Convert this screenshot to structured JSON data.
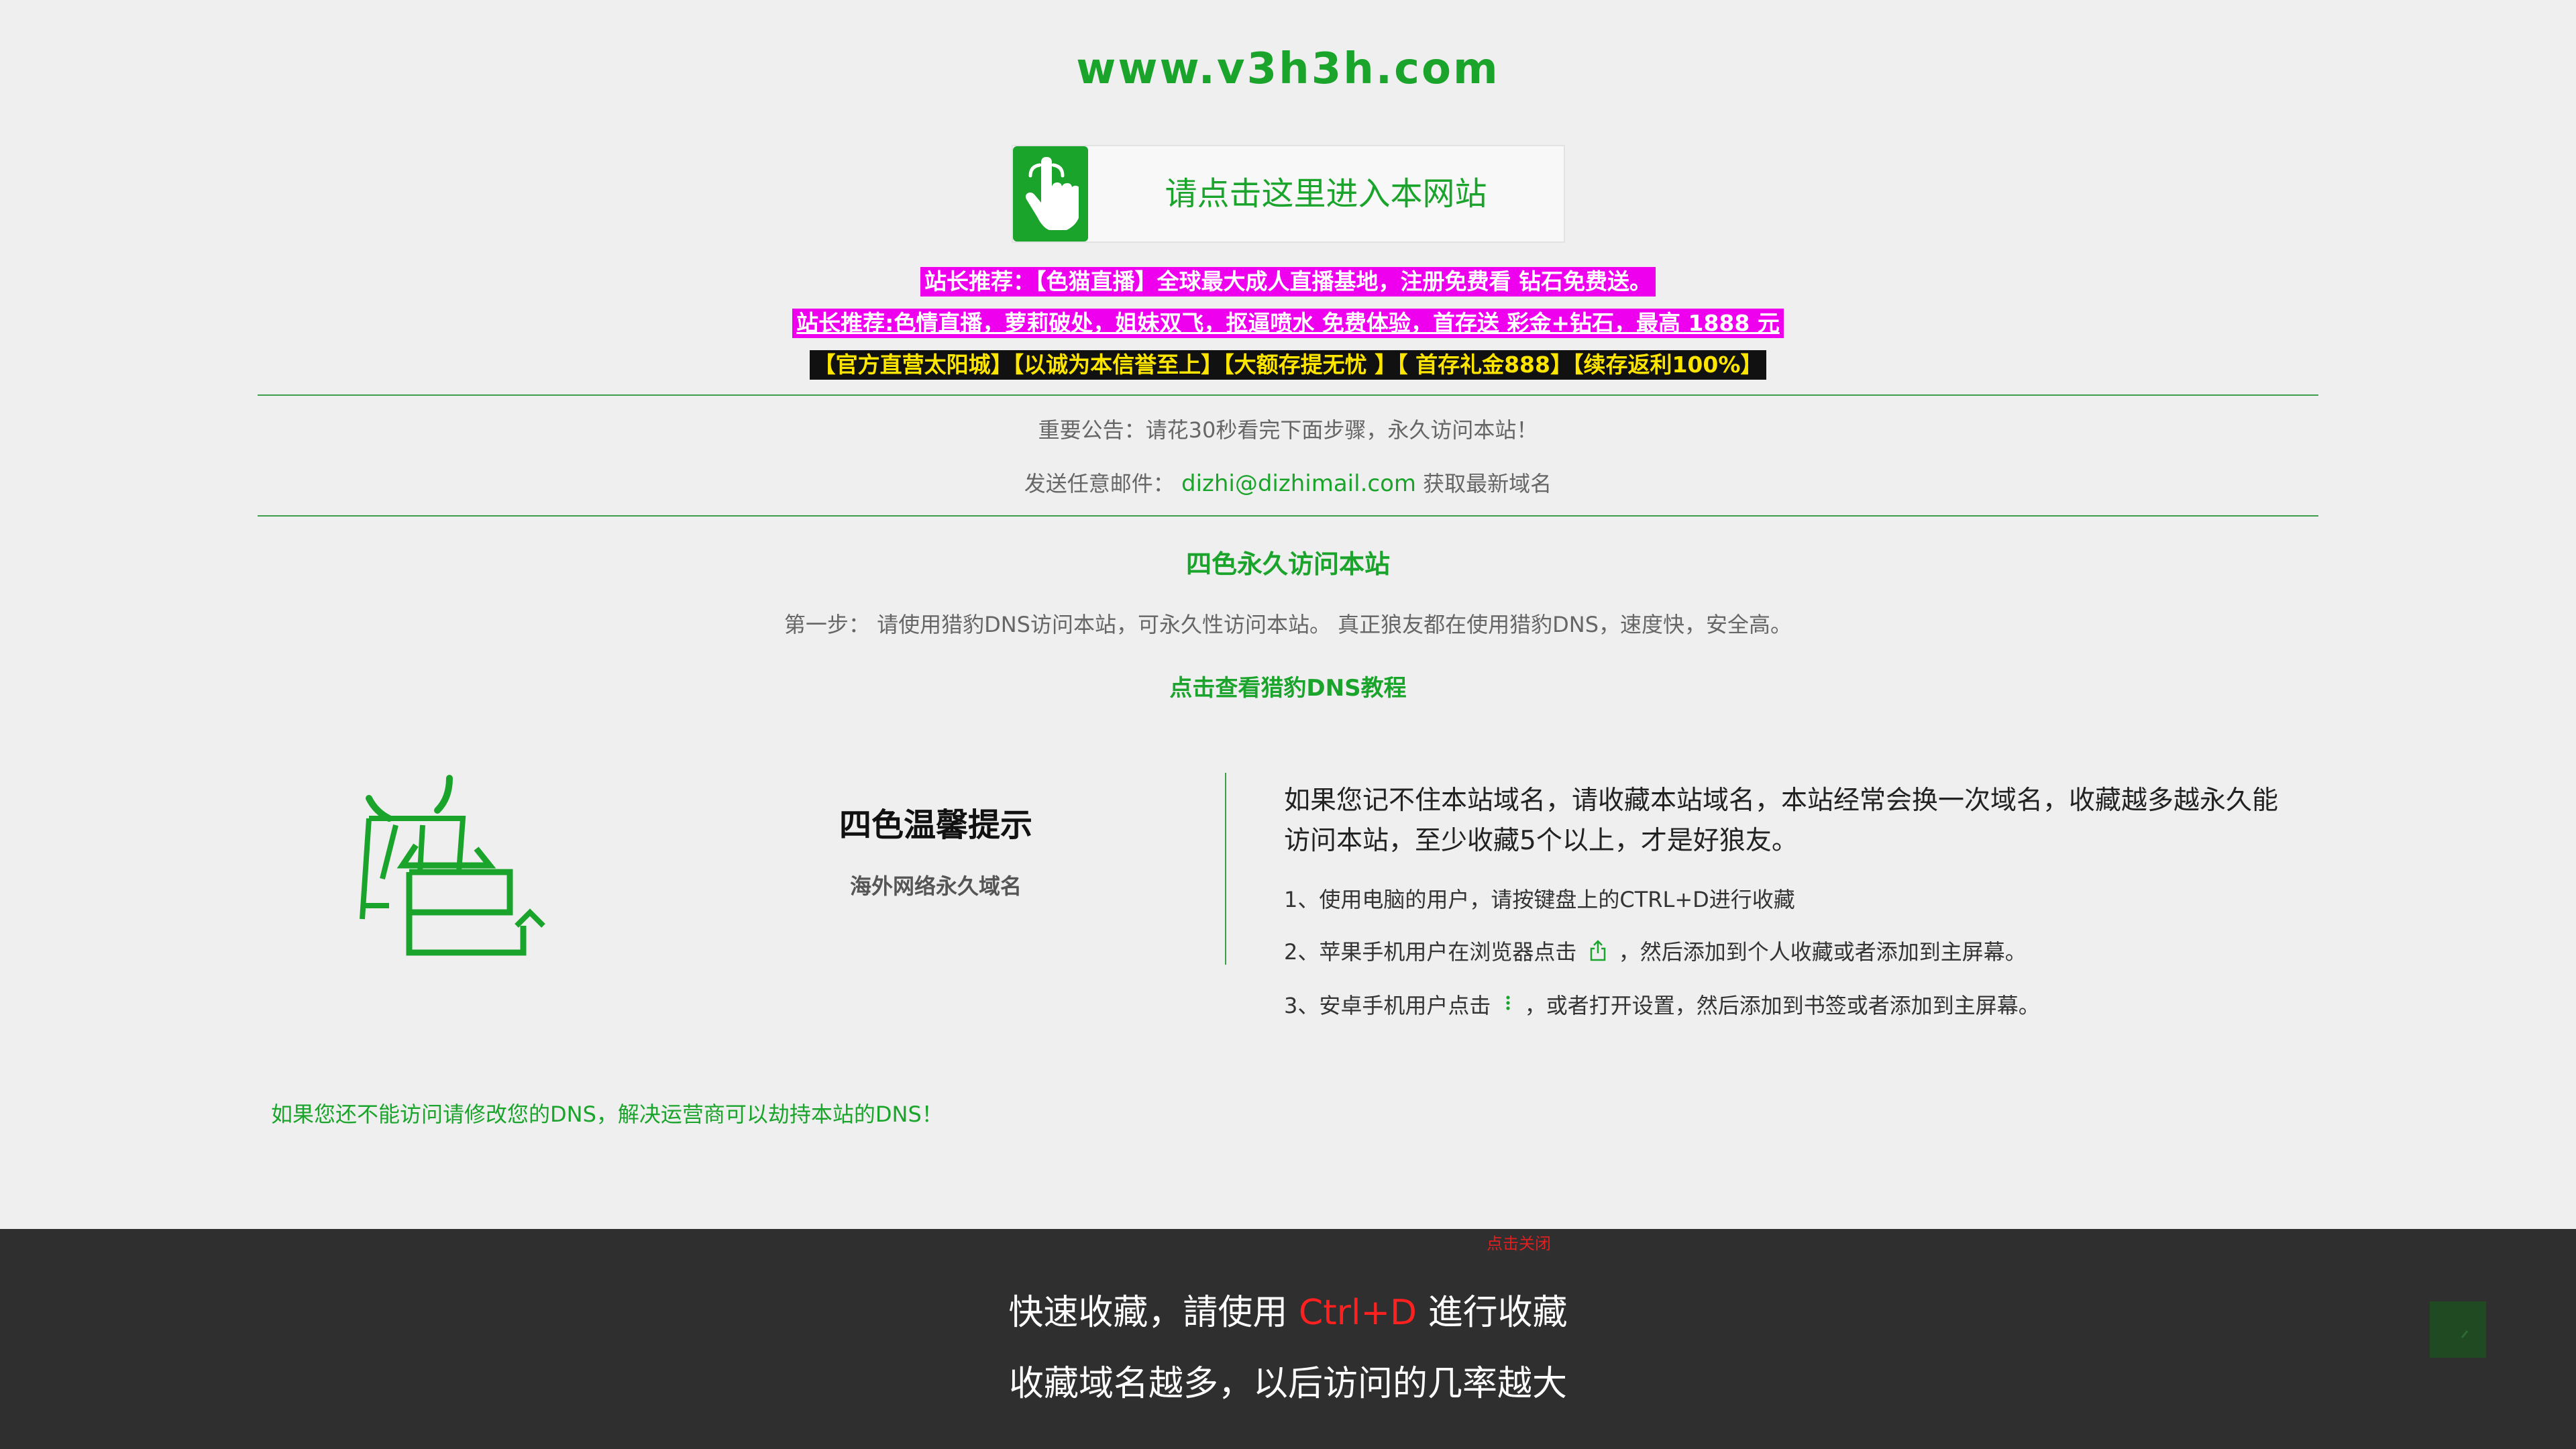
{
  "site": {
    "domain": "www.v3h3h.com"
  },
  "enter_button": {
    "label": "请点击这里进入本网站",
    "icon": "hand-pointer-icon"
  },
  "ads": [
    "站长推荐：【色猫直播】全球最大成人直播基地，注册免费看 钻石免费送。",
    "站长推荐:色情直播，萝莉破处，姐妹双飞，抠逼喷水  免费体验，首存送 彩金+钻石，最高 1888 元",
    "【官方直营太阳城】【以诚为本信誉至上】【大额存提无忧 】【 首存礼金888】【续存返利100%】"
  ],
  "notice": {
    "line1": "重要公告：请花30秒看完下面步骤，永久访问本站！",
    "line2_prefix": "发送任意邮件：",
    "email": "dizhi@dizhimail.com",
    "line2_suffix": " 获取最新域名"
  },
  "section": {
    "title": "四色永久访问本站",
    "step": "第一步： 请使用猎豹DNS访问本站，可永久性访问本站。 真正狼友都在使用猎豹DNS，速度快，安全高。",
    "tutorial_link": "点击查看猎豹DNS教程"
  },
  "tips": {
    "logo_alt": "四色",
    "title": "四色温馨提示",
    "subtitle": "海外网络永久域名",
    "body": "如果您记不住本站域名，请收藏本站域名，本站经常会换一次域名，收藏越多越永久能访问本站，至少收藏5个以上，才是好狼友。",
    "item1": "1、使用电脑的用户，请按键盘上的CTRL+D进行收藏",
    "item2_prefix": "2、苹果手机用户在浏览器点击",
    "item2_suffix": "，然后添加到个人收藏或者添加到主屏幕。",
    "item3_prefix": "3、安卓手机用户点击",
    "item3_suffix": "，或者打开设置，然后添加到书签或者添加到主屏幕。"
  },
  "dns_warning": "如果您还不能访问请修改您的DNS，解决运营商可以劫持本站的DNS！",
  "bottom_bar": {
    "close_label": "点击关闭",
    "line1_prefix": "快速收藏，請使用 ",
    "line1_key": "Ctrl+D",
    "line1_suffix": " 進行收藏",
    "line2": "收藏域名越多，以后访问的几率越大"
  },
  "colors": {
    "accent": "#1ba42b",
    "ad_bg": "#ee00ee",
    "ad3_bg": "#111111",
    "ad3_text": "#ffe600",
    "bar_bg": "#2f2f2f",
    "key_red": "#ff2020"
  }
}
